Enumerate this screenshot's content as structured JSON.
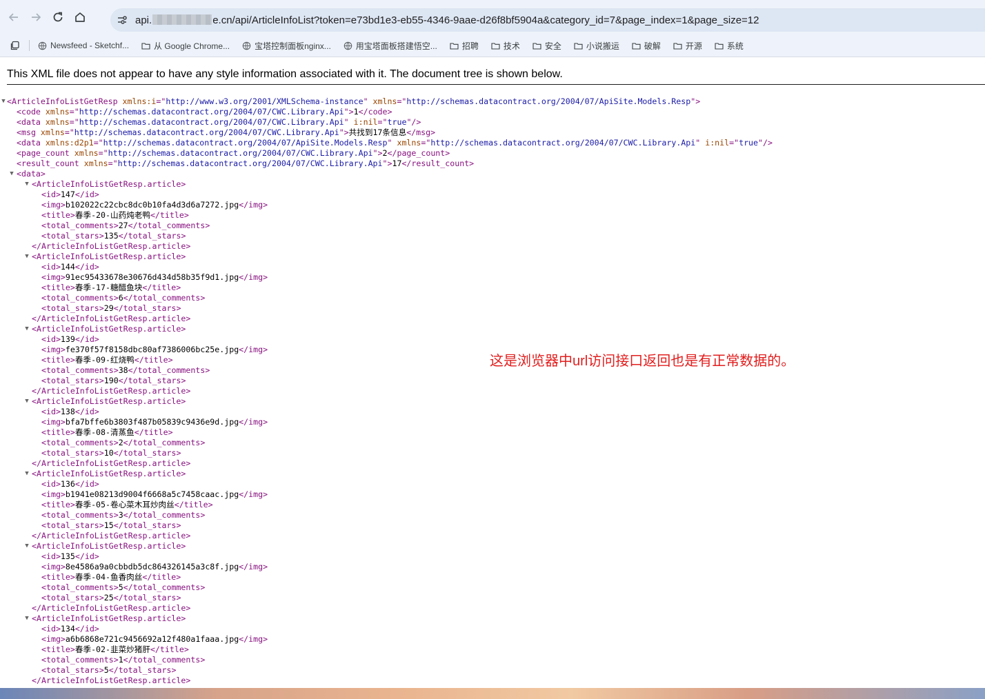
{
  "browser": {
    "url_prefix": "api.",
    "url_suffix": "e.cn/api/ArticleInfoList?token=e73bd1e3-eb55-4346-9aae-d26f8bf5904a&category_id=7&page_index=1&page_size=12",
    "bookmarks": [
      {
        "label": "Newsfeed - Sketchf...",
        "icon": "globe-icon"
      },
      {
        "label": "从 Google Chrome...",
        "icon": "folder-icon"
      },
      {
        "label": "宝塔控制面板nginx...",
        "icon": "globe-icon"
      },
      {
        "label": "用宝塔面板搭建悟空...",
        "icon": "globe-icon"
      },
      {
        "label": "招聘",
        "icon": "folder-icon"
      },
      {
        "label": "技术",
        "icon": "folder-icon"
      },
      {
        "label": "安全",
        "icon": "folder-icon"
      },
      {
        "label": "小说搬运",
        "icon": "folder-icon"
      },
      {
        "label": "破解",
        "icon": "folder-icon"
      },
      {
        "label": "开源",
        "icon": "folder-icon"
      },
      {
        "label": "系统",
        "icon": "folder-icon"
      }
    ]
  },
  "xml_notice": "This XML file does not appear to have any style information associated with it. The document tree is shown below.",
  "annotation": "这是浏览器中url访问接口返回也是有正常数据的。",
  "xml": {
    "root_tag": "ArticleInfoListGetResp",
    "ns_i": "http://www.w3.org/2001/XMLSchema-instance",
    "ns_root": "http://schemas.datacontract.org/2004/07/ApiSite.Models.Resp",
    "ns_lib": "http://schemas.datacontract.org/2004/07/CWC.Library.Api",
    "code": "1",
    "msg": "共找到17条信息",
    "page_count": "2",
    "result_count": "17",
    "article_tag": "ArticleInfoListGetResp.article",
    "articles": [
      {
        "id": "147",
        "img": "b102022c22cbc8dc0b10fa4d3d6a7272.jpg",
        "title": "春季-20-山药炖老鸭",
        "total_comments": "27",
        "total_stars": "135"
      },
      {
        "id": "144",
        "img": "91ec95433678e30676d434d58b35f9d1.jpg",
        "title": "春季-17-糖醋鱼块",
        "total_comments": "6",
        "total_stars": "29"
      },
      {
        "id": "139",
        "img": "fe370f57f8158dbc80af7386006bc25e.jpg",
        "title": "春季-09-红烧鸭",
        "total_comments": "38",
        "total_stars": "190"
      },
      {
        "id": "138",
        "img": "bfa7bffe6b3803f487b05839c9436e9d.jpg",
        "title": "春季-08-清蒸鱼",
        "total_comments": "2",
        "total_stars": "10"
      },
      {
        "id": "136",
        "img": "b1941e08213d9004f6668a5c7458caac.jpg",
        "title": "春季-05-卷心菜木耳炒肉丝",
        "total_comments": "3",
        "total_stars": "15"
      },
      {
        "id": "135",
        "img": "8e4586a9a0cbbdb5dc864326145a3c8f.jpg",
        "title": "春季-04-鱼香肉丝",
        "total_comments": "5",
        "total_stars": "25"
      },
      {
        "id": "134",
        "img": "a6b6868e721c9456692a12f480a1faaa.jpg",
        "title": "春季-02-韭菜炒猪肝",
        "total_comments": "1",
        "total_stars": "5"
      }
    ]
  }
}
